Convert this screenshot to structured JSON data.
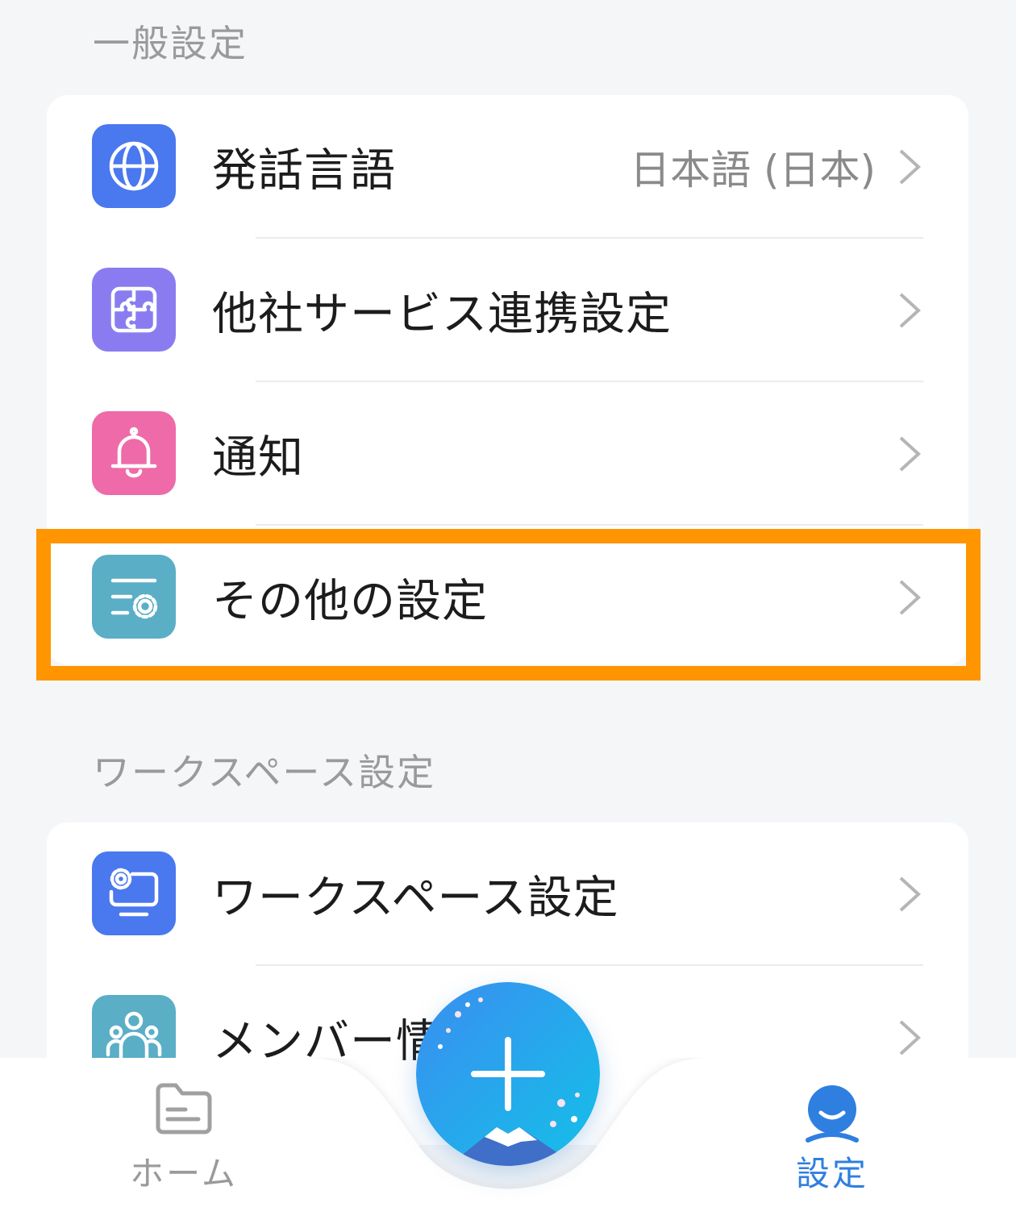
{
  "sections": {
    "general": {
      "title": "一般設定"
    },
    "workspace": {
      "title": "ワークスペース設定"
    }
  },
  "general_items": [
    {
      "label": "発話言語",
      "value": "日本語 (日本)",
      "icon": "globe-icon",
      "color": "#4a78ee"
    },
    {
      "label": "他社サービス連携設定",
      "icon": "puzzle-icon",
      "color": "#8a7cf0"
    },
    {
      "label": "通知",
      "icon": "bell-icon",
      "color": "#ee6aa8"
    },
    {
      "label": "その他の設定",
      "icon": "settings-sliders-icon",
      "color": "#5aaec6"
    }
  ],
  "workspace_items": [
    {
      "label": "ワークスペース設定",
      "icon": "monitor-gear-icon",
      "color": "#4a78ee"
    },
    {
      "label": "メンバー情",
      "icon": "members-icon",
      "color": "#5aaec6"
    }
  ],
  "tabbar": {
    "home_label": "ホーム",
    "settings_label": "設定",
    "active_color": "#2f7fe0",
    "inactive_color": "#9a9a9a"
  },
  "highlight_color": "#ff9500"
}
